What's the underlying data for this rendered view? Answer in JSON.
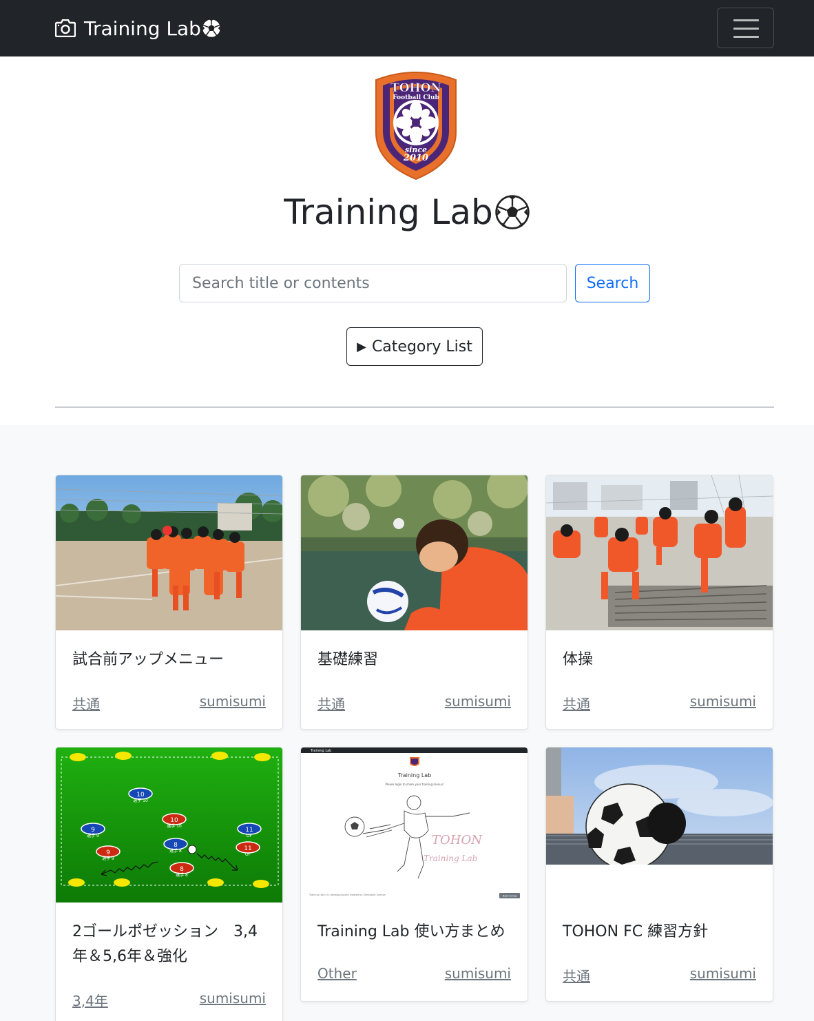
{
  "navbar": {
    "brand_text": "Training Lab",
    "camera_icon": "camera-icon",
    "ball_icon": "soccer-ball-icon",
    "menu_icon": "hamburger-menu-icon"
  },
  "hero": {
    "logo": {
      "line1": "TOHON",
      "line2": "Football Club",
      "line3": "since",
      "line4": "2010"
    },
    "title": "Training Lab"
  },
  "search": {
    "placeholder": "Search title or contents",
    "button_label": "Search"
  },
  "category_button": {
    "icon": "▶",
    "label": "Category List"
  },
  "cards": [
    {
      "title": "試合前アップメニュー",
      "category": "共通",
      "author": "sumisumi",
      "image": "team-huddle-photo"
    },
    {
      "title": "基礎練習",
      "category": "共通",
      "author": "sumisumi",
      "image": "child-with-ball-photo"
    },
    {
      "title": "体操",
      "category": "共通",
      "author": "sumisumi",
      "image": "stretching-photo"
    },
    {
      "title": "2ゴールポゼッション　3,4年＆5,6年＆強化",
      "category": "3,4年",
      "author": "sumisumi",
      "image": "tactics-board-diagram"
    },
    {
      "title": "Training Lab 使い方まとめ",
      "category": "Other",
      "author": "sumisumi",
      "image": "app-screenshot"
    },
    {
      "title": "TOHON FC 練習方針",
      "category": "共通",
      "author": "sumisumi",
      "image": "ball-sky-photo"
    }
  ],
  "diagram": {
    "players": [
      {
        "num": "10",
        "label": "選手 10",
        "team": "blue"
      },
      {
        "num": "10",
        "label": "選手 10",
        "team": "red"
      },
      {
        "num": "9",
        "label": "選手 9",
        "team": "blue"
      },
      {
        "num": "11",
        "label": "OF",
        "team": "blue"
      },
      {
        "num": "8",
        "label": "選手 8",
        "team": "blue"
      },
      {
        "num": "11",
        "label": "OF",
        "team": "red"
      },
      {
        "num": "9",
        "label": "選手 9",
        "team": "red"
      },
      {
        "num": "8",
        "label": "選手 8",
        "team": "red"
      }
    ]
  },
  "screenshot": {
    "header": "Training Lab",
    "title": "Training Lab",
    "subtitle": "Please login to share your training menus!",
    "sign1": "TOHON",
    "sign2": "Training Lab",
    "footer": "Training Lab is in developing and created by Shimazaki Sumiya",
    "button": "Back to top"
  },
  "colors": {
    "navbar": "#212529",
    "primary": "#0d6efd",
    "muted": "#6c757d",
    "grid_bg": "#f8f9fa"
  }
}
